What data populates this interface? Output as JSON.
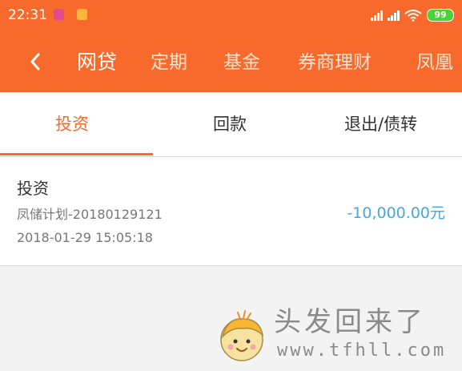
{
  "status_bar": {
    "time": "22:31",
    "battery": "99",
    "notification_icons": [
      "app-notification-icon",
      "app-notification-icon"
    ]
  },
  "nav": {
    "back_icon": "chevron-left-icon",
    "tabs": [
      "网贷",
      "定期",
      "基金",
      "券商理财",
      "凤凰"
    ],
    "active_tab": "网贷"
  },
  "record_tabs": {
    "items": [
      "投资",
      "回款",
      "退出/债转"
    ],
    "active": "投资"
  },
  "records": [
    {
      "type": "投资",
      "plan": "凤储计划-20180129121",
      "datetime": "2018-01-29 15:05:18",
      "amount": "-10,000.00元"
    }
  ],
  "watermark": {
    "title": "头发回来了",
    "url": "www.tfhll.com"
  },
  "colors": {
    "accent": "#f86a2b",
    "amount": "#45a7e0",
    "background": "#f3f3f3"
  }
}
